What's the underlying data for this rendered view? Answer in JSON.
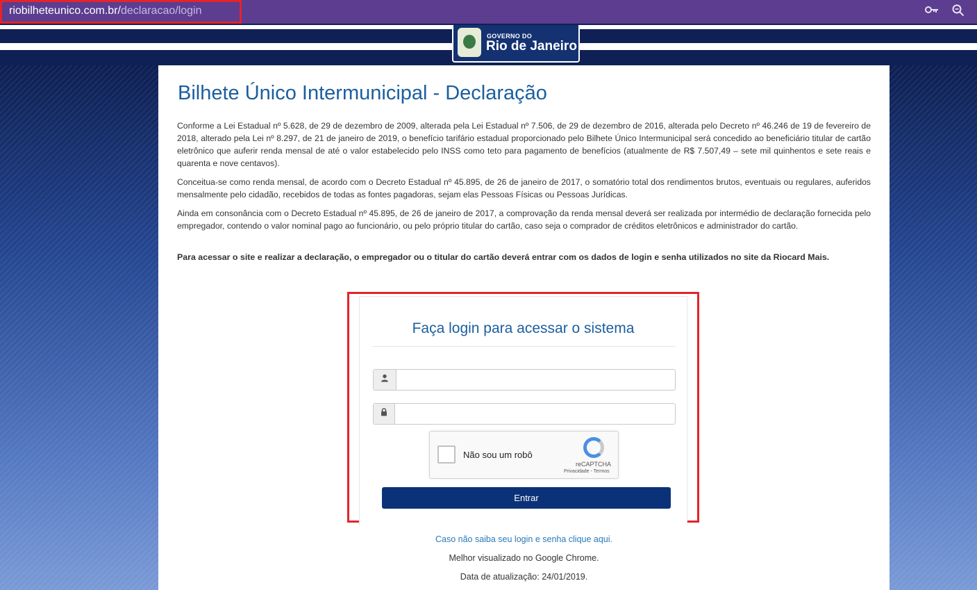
{
  "browser": {
    "url_domain": "riobilheteunico.com.br/",
    "url_path": "declaracao/login",
    "key_icon": "key-icon",
    "zoom_icon": "zoom-icon"
  },
  "header": {
    "logo_small": "GOVERNO DO",
    "logo_big": "Rio de Janeiro"
  },
  "main": {
    "title": "Bilhete Único Intermunicipal - Declaração",
    "paragraphs": [
      "Conforme a Lei Estadual nº 5.628, de 29 de dezembro de 2009, alterada pela Lei Estadual nº 7.506, de 29 de dezembro de 2016, alterada pelo Decreto nº 46.246 de 19 de fevereiro de 2018, alterado pela Lei nº 8.297, de 21 de janeiro de 2019, o benefício tarifário estadual proporcionado pelo Bilhete Único Intermunicipal será concedido ao beneficiário titular de cartão eletrônico que auferir renda mensal de até o valor estabelecido pelo INSS como teto para pagamento de benefícios (atualmente de R$ 7.507,49 – sete mil quinhentos e sete reais e quarenta e nove centavos).",
      "Conceitua-se como renda mensal, de acordo com o Decreto Estadual nº 45.895, de 26 de janeiro de 2017, o somatório total dos rendimentos brutos, eventuais ou regulares, auferidos mensalmente pelo cidadão, recebidos de todas as fontes pagadoras, sejam elas Pessoas Físicas ou Pessoas Jurídicas.",
      "Ainda em consonância com o Decreto Estadual nº 45.895, de 26 de janeiro de 2017, a comprovação da renda mensal deverá ser realizada por intermédio de declaração fornecida pelo empregador, contendo o valor nominal pago ao funcionário, ou pelo próprio titular do cartão, caso seja o comprador de créditos eletrônicos e administrador do cartão."
    ],
    "bold_note": "Para acessar o site e realizar a declaração, o empregador ou o titular do cartão deverá entrar com os dados de login e senha utilizados no site da Riocard Mais."
  },
  "login": {
    "title": "Faça login para acessar o sistema",
    "user_icon": "user-icon",
    "lock_icon": "lock-icon",
    "username_value": "",
    "password_value": "",
    "captcha_label": "Não sou um robô",
    "captcha_brand": "reCAPTCHA",
    "captcha_links": "Privacidade - Termos",
    "submit_label": "Entrar"
  },
  "footer": {
    "forgot_link": "Caso não saiba seu login e senha clique aqui.",
    "best_viewed": "Melhor visualizado no Google Chrome.",
    "updated": "Data de atualização: 24/01/2019."
  }
}
